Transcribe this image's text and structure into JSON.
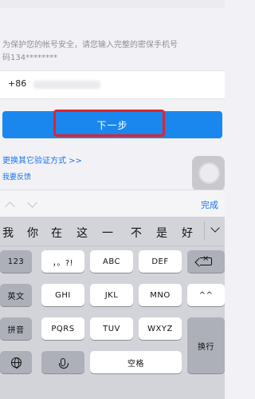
{
  "form": {
    "hint_line1": "为保护您的帐号安全，请您输入完整的密保手机号",
    "hint_line2": "码134********",
    "country_code": "+86",
    "next_button": "下一步",
    "other_verify_link": "更换其它验证方式 >>",
    "feedback_link": "我要反馈"
  },
  "accessory_bar": {
    "done": "完成",
    "icons": [
      "chevron-up-icon",
      "chevron-down-icon"
    ]
  },
  "keyboard": {
    "candidates": [
      "我",
      "你",
      "在",
      "这",
      "一",
      "不",
      "是",
      "好"
    ],
    "rows": {
      "r1": [
        "123",
        "，。?!",
        "ABC",
        "DEF"
      ],
      "r2": [
        "英文",
        "GHI",
        "JKL",
        "MNO",
        "^^"
      ],
      "r3": [
        "拼音",
        "PQRS",
        "TUV",
        "WXYZ",
        "换行"
      ],
      "r4": [
        "空格"
      ]
    },
    "icons": [
      "backspace-icon",
      "globe-icon",
      "microphone-icon",
      "expand-chevron-icon"
    ]
  },
  "colors": {
    "primary_button": "#1a87ef",
    "link": "#1a73e8",
    "highlight_box": "#e3222b"
  }
}
